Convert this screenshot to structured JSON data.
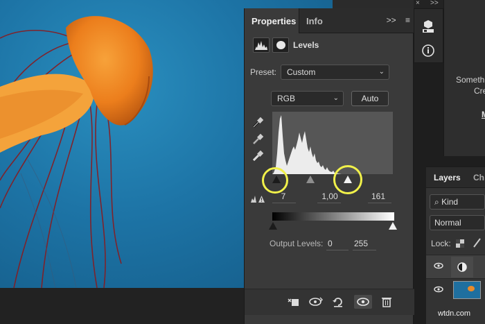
{
  "properties_panel": {
    "tabs": [
      {
        "label": "Properties"
      },
      {
        "label": "Info"
      }
    ],
    "tab_tools": {
      "collapse": ">>",
      "menu": "≡"
    },
    "adjustment": {
      "title": "Levels",
      "icon": "histogram-icon",
      "mask_icon": "layer-mask-icon"
    },
    "preset": {
      "label": "Preset:",
      "value": "Custom"
    },
    "channel": {
      "value": "RGB"
    },
    "auto_label": "Auto",
    "eyedroppers": [
      "black-point-eyedropper-icon",
      "gray-point-eyedropper-icon",
      "white-point-eyedropper-icon"
    ],
    "input_levels": {
      "black": "7",
      "gamma": "1,00",
      "white": "161"
    },
    "output_levels": {
      "label": "Output Levels:",
      "low": "0",
      "high": "255"
    },
    "highlight_color": "#f1f14a",
    "bottom_icons": [
      "clip-to-layer-icon",
      "view-previous-state-icon",
      "reset-icon",
      "visibility-eye-icon",
      "delete-icon"
    ]
  },
  "top_bar": {
    "close": "×",
    "collapse": ">>"
  },
  "tool_column": {
    "icons": [
      "3d-cube-icon",
      "info-icon"
    ]
  },
  "right_pane": {
    "line1": "Someth",
    "line2": "Cre",
    "line3": "M"
  },
  "layers_panel": {
    "tabs": [
      {
        "label": "Layers"
      },
      {
        "label": "Ch"
      }
    ],
    "kind": "Kind",
    "blend_mode": "Normal",
    "lock_label": "Lock:",
    "rows": [
      {
        "type": "adjustment-layer"
      },
      {
        "type": "image-layer"
      }
    ]
  },
  "watermark": "wtdn.com"
}
